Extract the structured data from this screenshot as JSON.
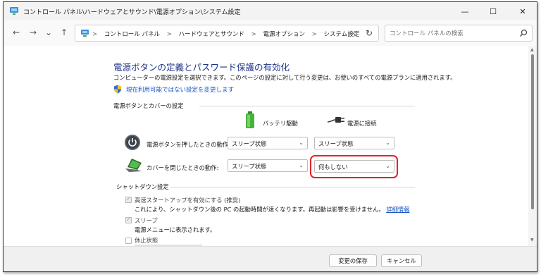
{
  "window": {
    "title": "コントロール パネル\\ハードウェアとサウンド\\電源オプション\\システム設定",
    "minimize": "—",
    "maximize": "☐",
    "close": "✕"
  },
  "nav": {
    "back": "←",
    "forward": "→",
    "recent": "⌄",
    "up": "↑"
  },
  "address": {
    "crumbs": [
      "コントロール パネル",
      "ハードウェアとサウンド",
      "電源オプション",
      "システム設定"
    ],
    "separator": ">",
    "dropdown": "⌄",
    "refresh": "↻"
  },
  "search": {
    "placeholder": "コントロール パネルの検索"
  },
  "main": {
    "heading": "電源ボタンの定義とパスワード保護の有効化",
    "subtext": "コンピューターの電源設定を選択できます。このページの設定に対して行う変更は、お使いのすべての電源プランに適用されます。",
    "admin_link": "現在利用可能ではない設定を変更します",
    "power_section": {
      "label": "電源ボタンとカバーの設定",
      "col_battery": "バッテリ駆動",
      "col_plugged": "電源に接続",
      "rows": [
        {
          "label": "電源ボタンを押したときの動作:",
          "battery": "スリープ状態",
          "plugged": "スリープ状態"
        },
        {
          "label": "カバーを閉じたときの動作:",
          "battery": "スリープ状態",
          "plugged": "何もしない"
        }
      ]
    },
    "shutdown_section": {
      "label": "シャットダウン設定",
      "items": [
        {
          "label": "高速スタートアップを有効にする (推奨)",
          "checked": true,
          "desc": "これにより、シャットダウン後の PC の起動時間が速くなります。再起動は影響を受けません。",
          "link": "詳細情報"
        },
        {
          "label": "スリープ",
          "checked": true,
          "desc": "電源メニューに表示されます。"
        },
        {
          "label": "休止状態",
          "checked": false
        }
      ]
    }
  },
  "footer": {
    "save": "変更の保存",
    "cancel": "キャンセル"
  },
  "colors": {
    "heading": "#1e3287",
    "link": "#1a56c4",
    "highlight": "#e0242a"
  }
}
